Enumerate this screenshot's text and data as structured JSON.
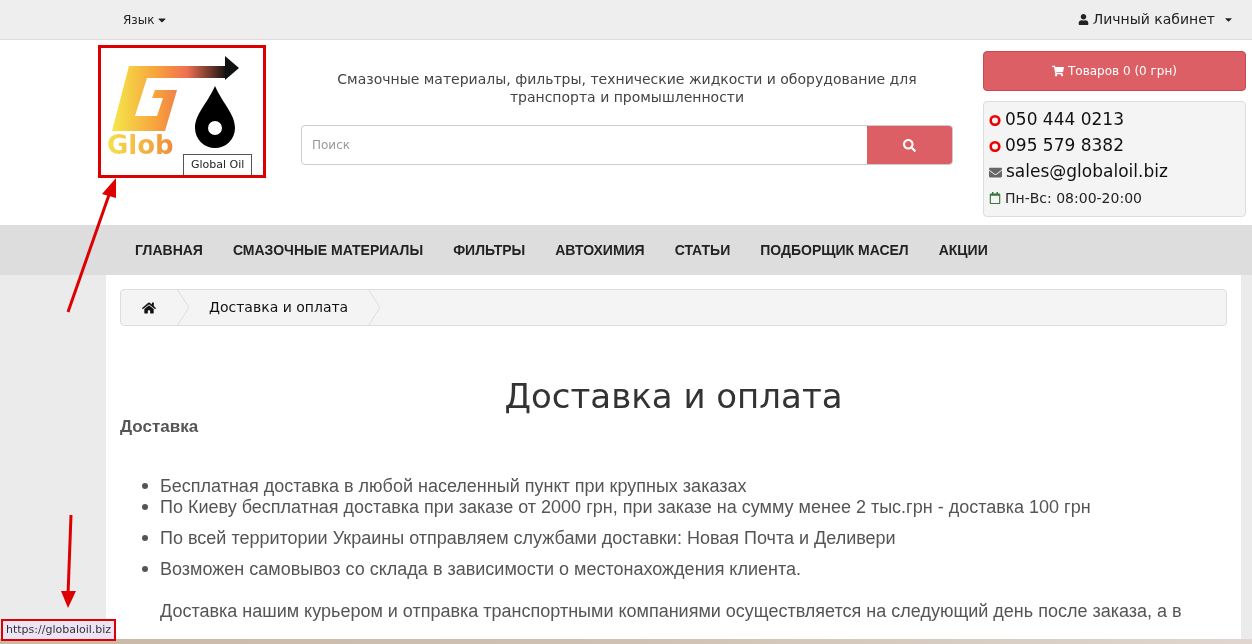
{
  "top_bar": {
    "language": "Язык",
    "account": "Личный кабинет"
  },
  "header": {
    "logo_text": "Glob",
    "logo_tooltip": "Global Oil",
    "tagline": "Смазочные материалы, фильтры, технические жидкости и оборудование для транспорта и промышленности",
    "search": {
      "placeholder": "Поиск"
    },
    "cart": "Товаров 0 (0 грн)",
    "contacts": [
      {
        "kind": "phone",
        "text": "050 444 0213"
      },
      {
        "kind": "phone",
        "text": "095 579 8382"
      },
      {
        "kind": "email",
        "text": "sales@globaloil.biz"
      },
      {
        "kind": "hours",
        "text": "Пн-Вс: 08:00-20:00"
      }
    ]
  },
  "nav": [
    "ГЛАВНАЯ",
    "СМАЗОЧНЫЕ МАТЕРИАЛЫ",
    "ФИЛЬТРЫ",
    "АВТОХИМИЯ",
    "СТАТЬИ",
    "ПОДБОРЩИК МАСЕЛ",
    "АКЦИИ"
  ],
  "breadcrumb": [
    "Доставка и оплата"
  ],
  "content": {
    "title": "Доставка и оплата",
    "section": "Доставка",
    "list": [
      {
        "text": "Бесплатная доставка в любой  населенный пункт при крупных заказах",
        "gap": false
      },
      {
        "text": "По Киеву бесплатная доставка при заказе от 2000 грн, при заказе на сумму менее 2 тыс.грн - доставка 100 грн",
        "gap": false
      },
      {
        "text": "По всей территории Украины отправляем службами доставки: Новая Почта и Деливери",
        "gap": true
      },
      {
        "text": "Возможен самовывоз со склада в зависимости о местонахождения клиента.",
        "gap": true
      }
    ],
    "paragraph": "Доставка нашим курьером и отправка транспортными компаниями осуществляется на следующий день после заказа, а в"
  },
  "status_url": "https://globaloil.biz"
}
